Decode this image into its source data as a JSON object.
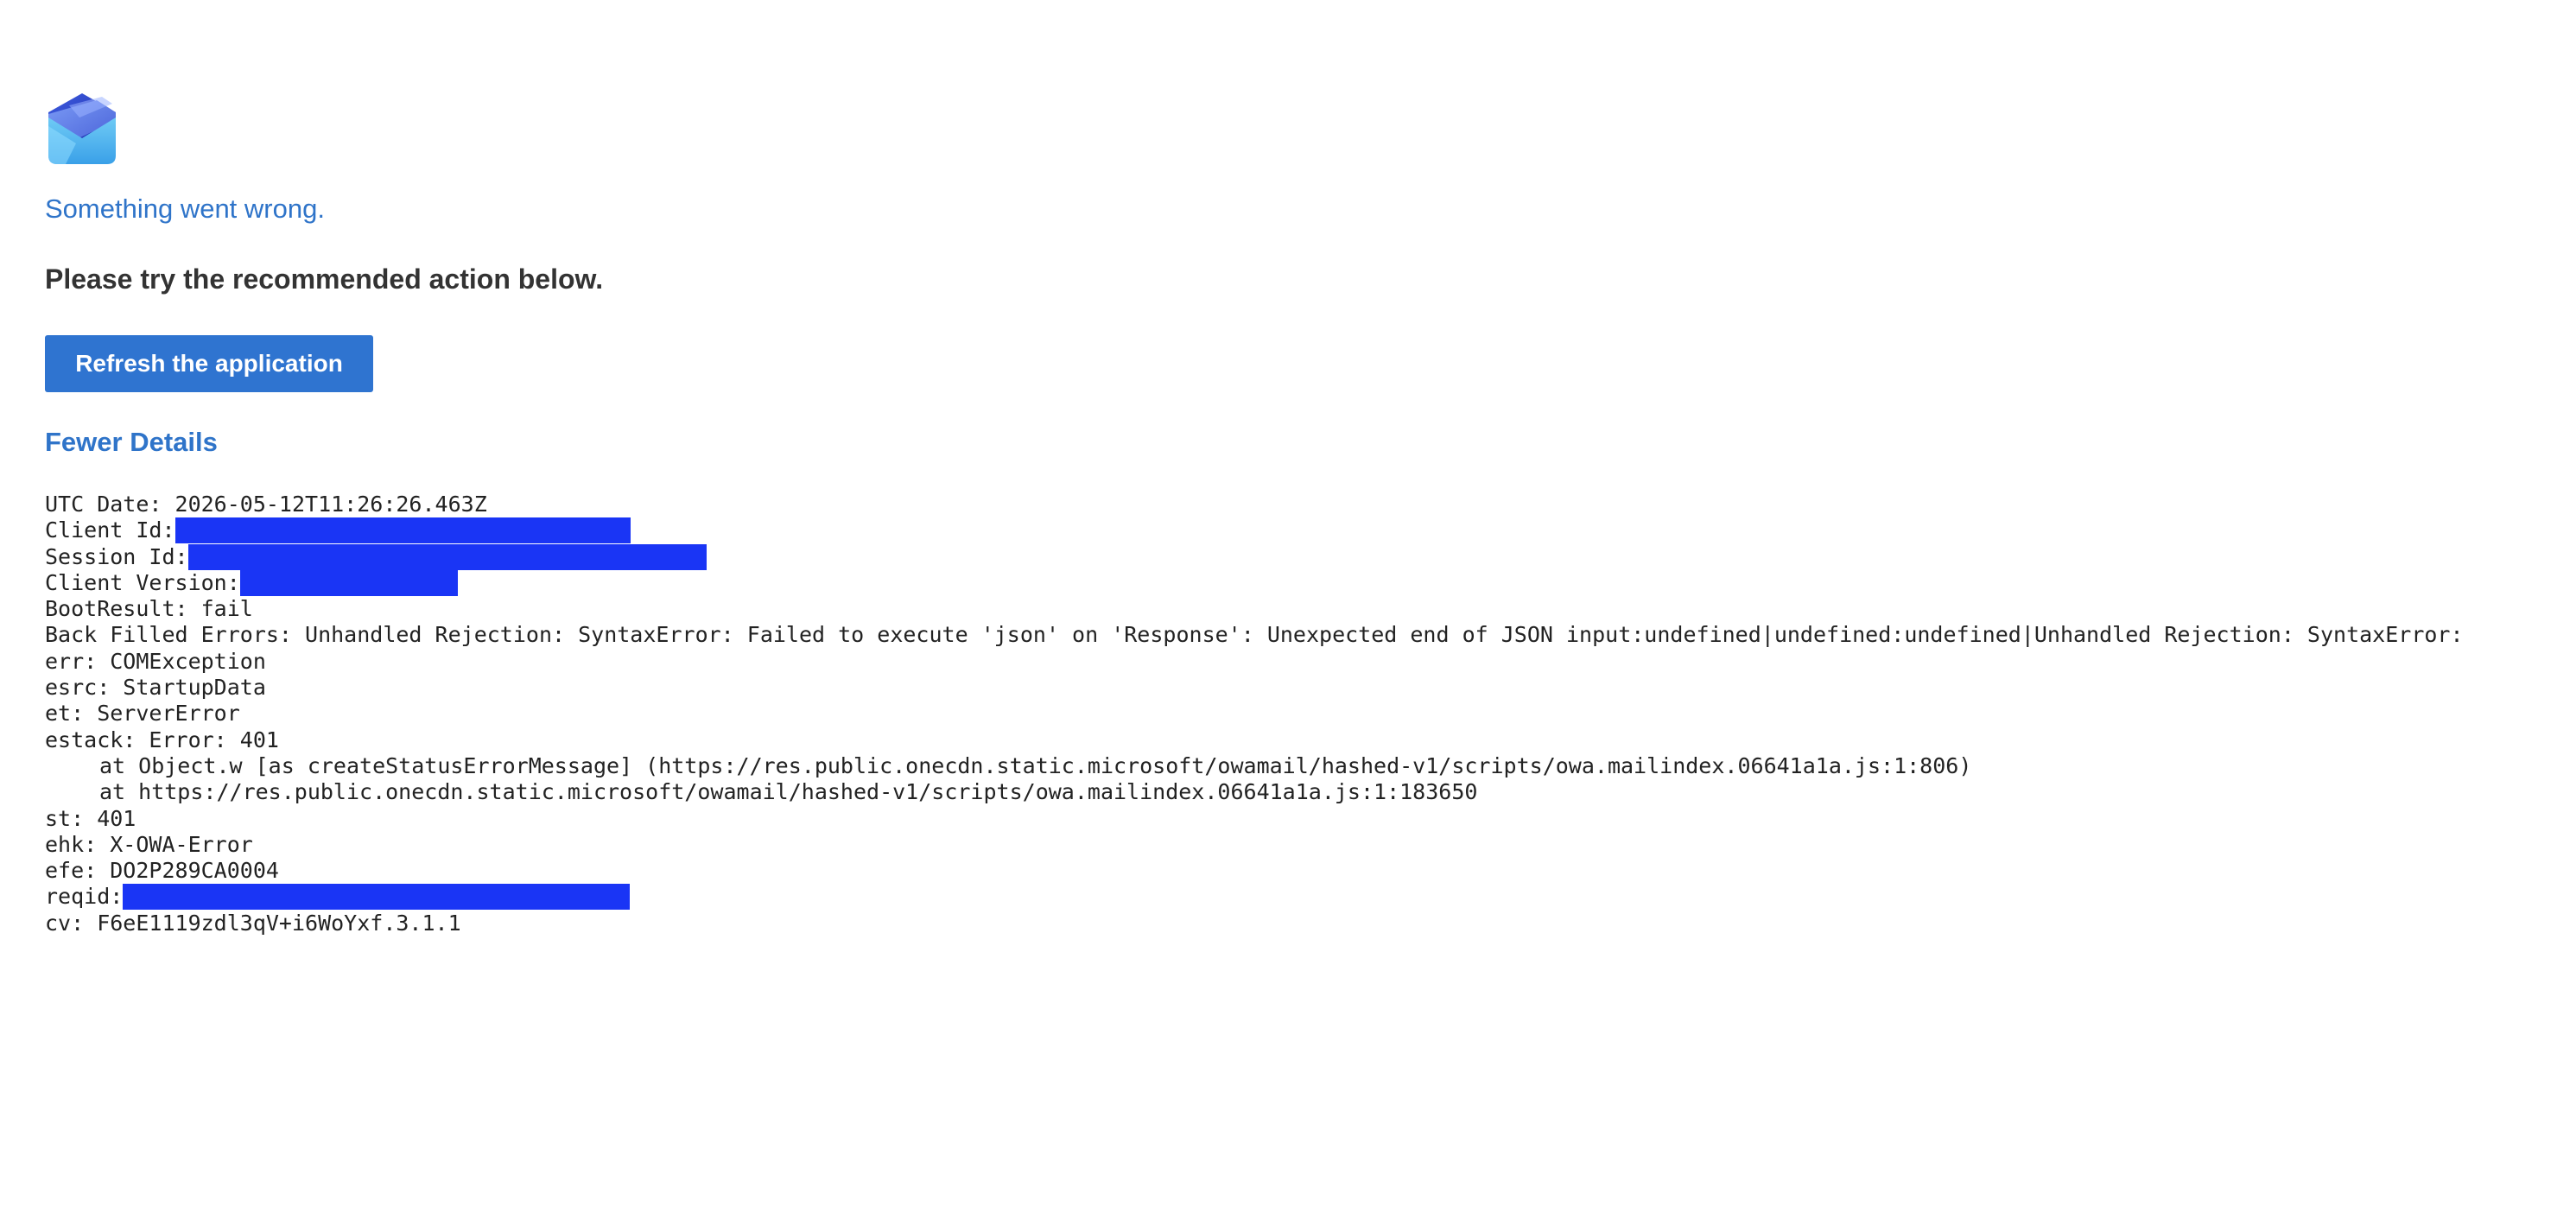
{
  "logo": {
    "icon": "outlook-envelope-icon"
  },
  "error": {
    "headline": "Something went wrong.",
    "subhead": "Please try the recommended action below.",
    "refresh_label": "Refresh the application",
    "details_toggle_label": "Fewer Details"
  },
  "details": {
    "utc_date": "UTC Date: 2026-05-12T11:26:26.463Z",
    "client_id_label": "Client Id:",
    "session_id_label": "Session Id:",
    "client_version_label": "Client Version:",
    "boot_result": "BootResult: fail",
    "back_filled_errors": "Back Filled Errors: Unhandled Rejection: SyntaxError: Failed to execute 'json' on 'Response': Unexpected end of JSON input:undefined|undefined:undefined|Unhandled Rejection: SyntaxError:",
    "err": "err: COMException",
    "esrc": "esrc: StartupData",
    "et": "et: ServerError",
    "estack": "estack: Error: 401",
    "estack_line1": "at Object.w [as createStatusErrorMessage] (https://res.public.onecdn.static.microsoft/owamail/hashed-v1/scripts/owa.mailindex.06641a1a.js:1:806)",
    "estack_line2": "at https://res.public.onecdn.static.microsoft/owamail/hashed-v1/scripts/owa.mailindex.06641a1a.js:1:183650",
    "st": "st: 401",
    "ehk": "ehk: X-OWA-Error",
    "efe": "efe: DO2P289CA0004",
    "reqid_label": "reqid:",
    "cv": "cv: F6eE1119zdl3qV+i6WoYxf.3.1.1"
  },
  "colors": {
    "accent": "#2f74c9",
    "button": "#2f74d0",
    "redaction": "#1a35f5"
  }
}
